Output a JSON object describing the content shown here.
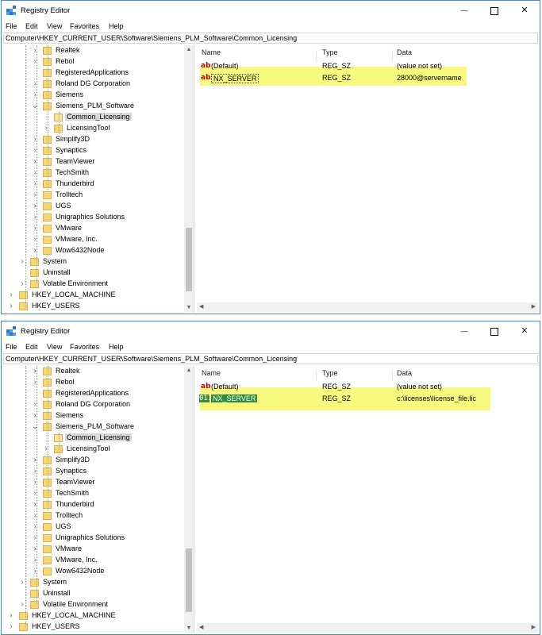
{
  "windows": [
    {
      "title": "Registry Editor",
      "menu": [
        "File",
        "Edit",
        "View",
        "Favorites",
        "Help"
      ],
      "address": "Computer\\HKEY_CURRENT_USER\\Software\\Siemens_PLM_Software\\Common_Licensing",
      "tree": [
        {
          "label": "Realtek",
          "indent": 3,
          "exp": ">"
        },
        {
          "label": "Rebol",
          "indent": 3,
          "exp": ">"
        },
        {
          "label": "RegisteredApplications",
          "indent": 3,
          "exp": ""
        },
        {
          "label": "Roland DG Corporation",
          "indent": 3,
          "exp": ">"
        },
        {
          "label": "Siemens",
          "indent": 3,
          "exp": ">"
        },
        {
          "label": "Siemens_PLM_Software",
          "indent": 3,
          "exp": "v"
        },
        {
          "label": "Common_Licensing",
          "indent": 4,
          "exp": "",
          "selected": true,
          "open": true
        },
        {
          "label": "LicensingTool",
          "indent": 4,
          "exp": ">"
        },
        {
          "label": "Simplify3D",
          "indent": 3,
          "exp": ">"
        },
        {
          "label": "Synaptics",
          "indent": 3,
          "exp": ">"
        },
        {
          "label": "TeamViewer",
          "indent": 3,
          "exp": ">"
        },
        {
          "label": "TechSmith",
          "indent": 3,
          "exp": ">"
        },
        {
          "label": "Thunderbird",
          "indent": 3,
          "exp": ">"
        },
        {
          "label": "Trolltech",
          "indent": 3,
          "exp": ">"
        },
        {
          "label": "UGS",
          "indent": 3,
          "exp": ">"
        },
        {
          "label": "Unigraphics Solutions",
          "indent": 3,
          "exp": ">"
        },
        {
          "label": "VMware",
          "indent": 3,
          "exp": ">"
        },
        {
          "label": "VMware, Inc.",
          "indent": 3,
          "exp": ">"
        },
        {
          "label": "Wow6432Node",
          "indent": 3,
          "exp": ">"
        },
        {
          "label": "System",
          "indent": 2,
          "exp": ">"
        },
        {
          "label": "Uninstall",
          "indent": 2,
          "exp": ""
        },
        {
          "label": "Volatile Environment",
          "indent": 2,
          "exp": ">"
        },
        {
          "label": "HKEY_LOCAL_MACHINE",
          "indent": 1,
          "exp": ">"
        },
        {
          "label": "HKEY_USERS",
          "indent": 1,
          "exp": ">"
        }
      ],
      "columns": {
        "name": "Name",
        "type": "Type",
        "data": "Data"
      },
      "values": [
        {
          "name": "(Default)",
          "type": "REG_SZ",
          "data": "(value not set)",
          "icon": "ab"
        },
        {
          "name": "NX_SERVER",
          "type": "REG_SZ",
          "data": "28000@servername",
          "icon": "ab",
          "style": "edit"
        }
      ],
      "highlight": true
    },
    {
      "title": "Registry Editor",
      "menu": [
        "File",
        "Edit",
        "View",
        "Favorites",
        "Help"
      ],
      "address": "Computer\\HKEY_CURRENT_USER\\Software\\Siemens_PLM_Software\\Common_Licensing",
      "tree": [
        {
          "label": "Realtek",
          "indent": 3,
          "exp": ">"
        },
        {
          "label": "Rebol",
          "indent": 3,
          "exp": ">"
        },
        {
          "label": "RegisteredApplications",
          "indent": 3,
          "exp": ""
        },
        {
          "label": "Roland DG Corporation",
          "indent": 3,
          "exp": ">"
        },
        {
          "label": "Siemens",
          "indent": 3,
          "exp": ">"
        },
        {
          "label": "Siemens_PLM_Software",
          "indent": 3,
          "exp": "v"
        },
        {
          "label": "Common_Licensing",
          "indent": 4,
          "exp": "",
          "selected": true,
          "open": true
        },
        {
          "label": "LicensingTool",
          "indent": 4,
          "exp": ">"
        },
        {
          "label": "Simplify3D",
          "indent": 3,
          "exp": ">"
        },
        {
          "label": "Synaptics",
          "indent": 3,
          "exp": ">"
        },
        {
          "label": "TeamViewer",
          "indent": 3,
          "exp": ">"
        },
        {
          "label": "TechSmith",
          "indent": 3,
          "exp": ">"
        },
        {
          "label": "Thunderbird",
          "indent": 3,
          "exp": ">"
        },
        {
          "label": "Trolltech",
          "indent": 3,
          "exp": ">"
        },
        {
          "label": "UGS",
          "indent": 3,
          "exp": ">"
        },
        {
          "label": "Unigraphics Solutions",
          "indent": 3,
          "exp": ">"
        },
        {
          "label": "VMware",
          "indent": 3,
          "exp": ">"
        },
        {
          "label": "VMware, Inc.",
          "indent": 3,
          "exp": ">"
        },
        {
          "label": "Wow6432Node",
          "indent": 3,
          "exp": ">"
        },
        {
          "label": "System",
          "indent": 2,
          "exp": ">"
        },
        {
          "label": "Uninstall",
          "indent": 2,
          "exp": ""
        },
        {
          "label": "Volatile Environment",
          "indent": 2,
          "exp": ">"
        },
        {
          "label": "HKEY_LOCAL_MACHINE",
          "indent": 1,
          "exp": ">"
        },
        {
          "label": "HKEY_USERS",
          "indent": 1,
          "exp": ">"
        }
      ],
      "columns": {
        "name": "Name",
        "type": "Type",
        "data": "Data"
      },
      "values": [
        {
          "name": "(Default)",
          "type": "REG_SZ",
          "data": "(value not set)",
          "icon": "ab"
        },
        {
          "name": "NX_SERVER",
          "type": "REG_SZ",
          "data": "c:\\licenses\\license_file.lic",
          "icon": "bin",
          "style": "selected"
        }
      ],
      "highlight": true
    }
  ],
  "colors": {
    "accent": "#3c8ad8",
    "highlight": "#f7f96a",
    "selection_green": "#2e8b3e",
    "folder": "#f7d774"
  },
  "icons": {
    "app": "registry-editor-icon",
    "minimize": "minimize-icon",
    "maximize": "maximize-icon",
    "close": "close-icon",
    "string_value": "string-value-icon",
    "binary_value": "binary-value-icon"
  }
}
